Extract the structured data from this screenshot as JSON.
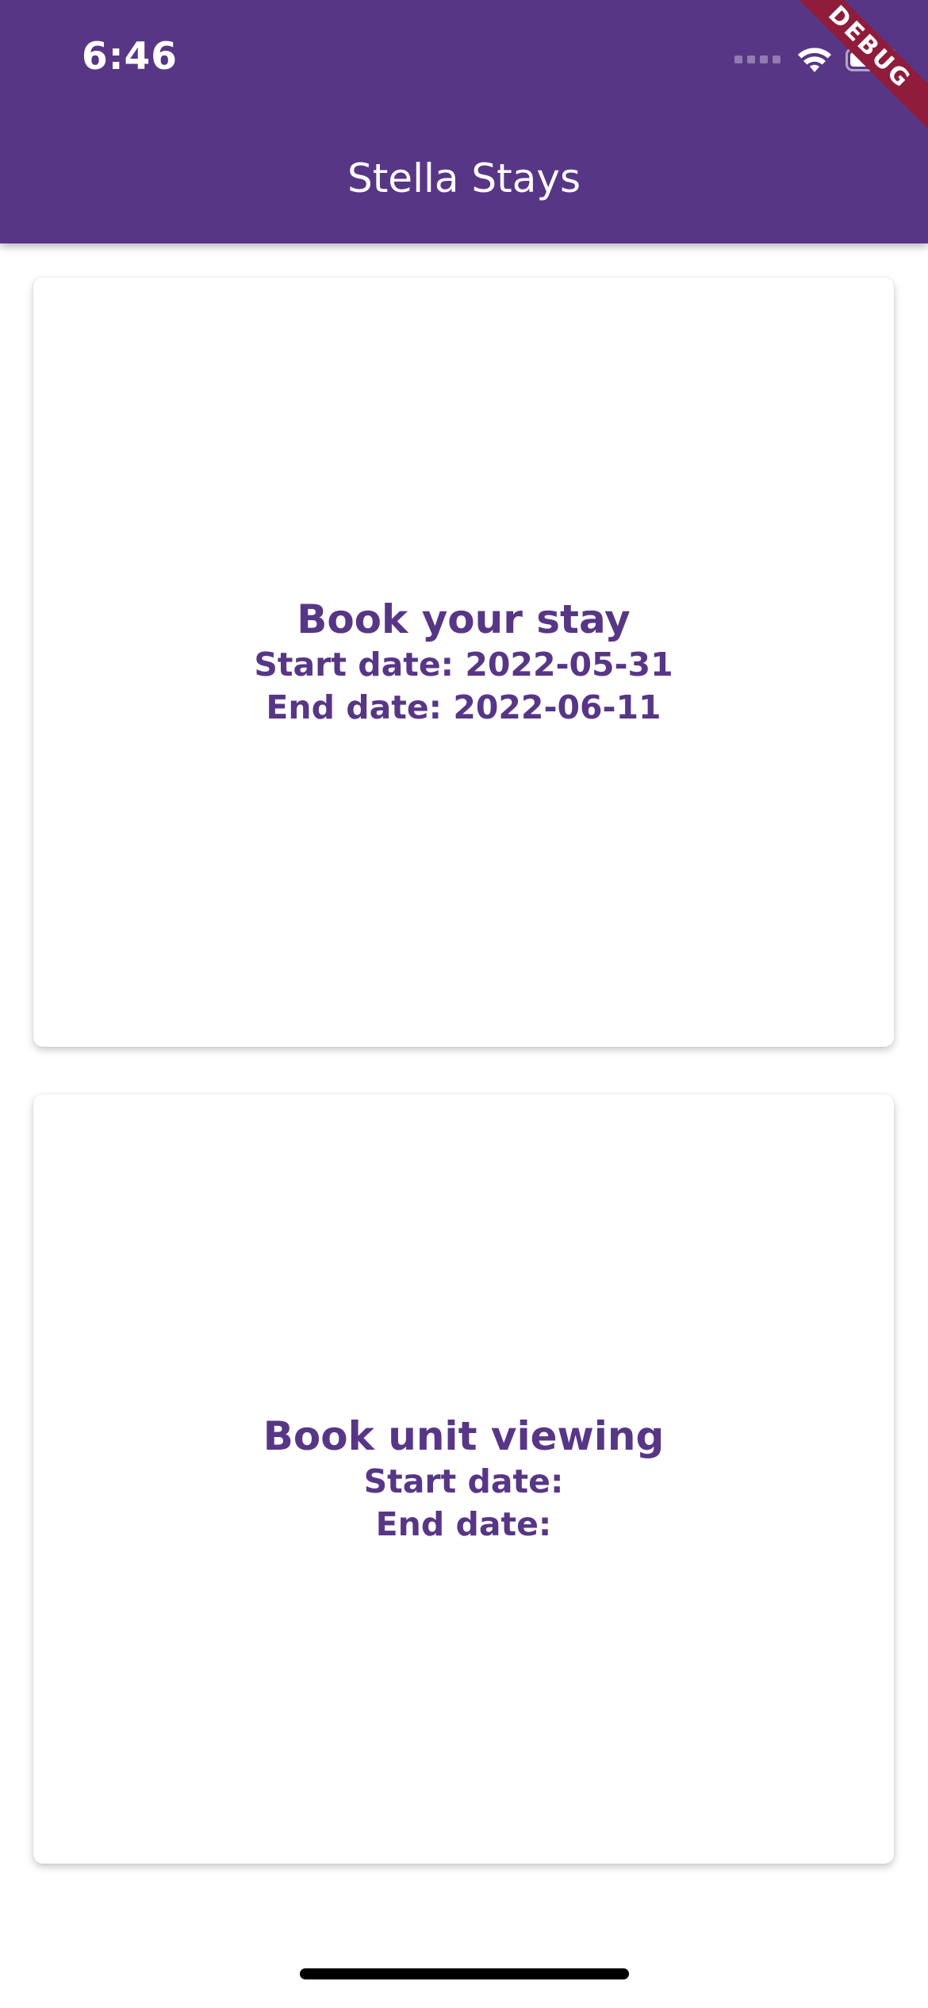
{
  "status_bar": {
    "time": "6:46",
    "battery_level": 0.6
  },
  "app_bar": {
    "title": "Stella Stays",
    "background_color": "#583686"
  },
  "debug_banner": {
    "label": "DEBUG",
    "color": "#8f1c3b"
  },
  "cards": [
    {
      "title": "Book your stay",
      "start_label": "Start date:",
      "start_value": "2022-05-31",
      "end_label": "End date:",
      "end_value": "2022-06-11"
    },
    {
      "title": "Book unit viewing",
      "start_label": "Start date:",
      "start_value": "",
      "end_label": "End date:",
      "end_value": ""
    }
  ],
  "colors": {
    "accent": "#583686",
    "text_on_accent": "#ffffff"
  },
  "icons": {
    "wifi": "wifi-icon",
    "battery": "battery-icon",
    "signal": "cellular-signal-icon"
  }
}
